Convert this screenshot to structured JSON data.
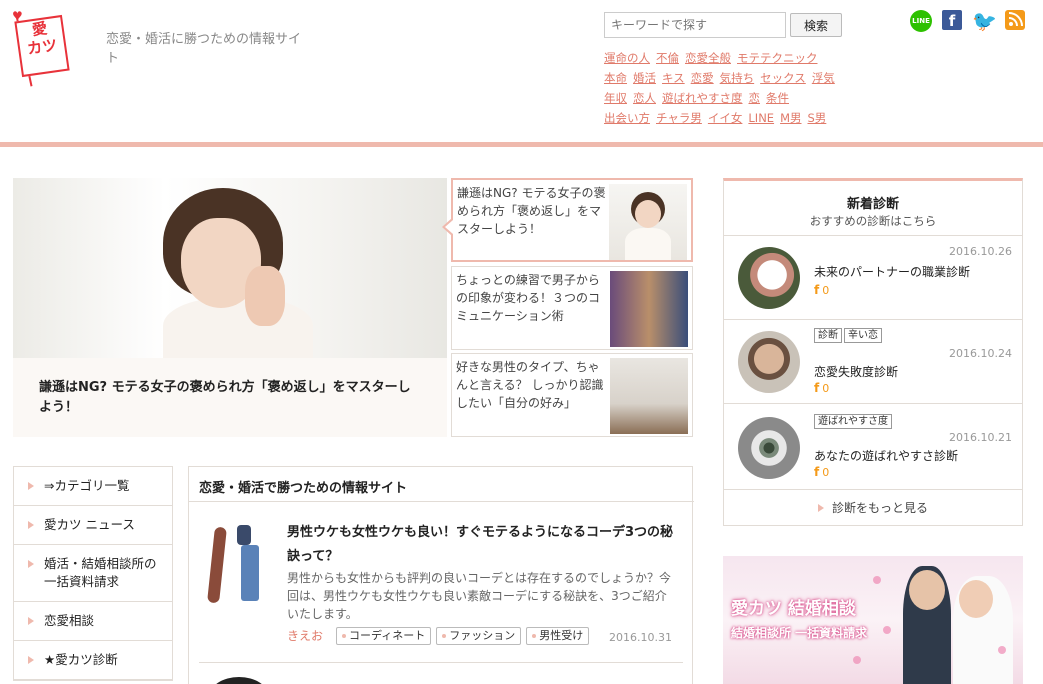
{
  "header": {
    "logo_text_top": "愛",
    "logo_text_bottom": "カツ",
    "tagline": "恋愛・婚活に勝つための情報サイト",
    "search": {
      "placeholder": "キーワードで探す",
      "button_label": "検索"
    },
    "social": [
      "line-icon",
      "facebook-icon",
      "twitter-icon",
      "rss-icon"
    ],
    "social_line_label": "LINE",
    "social_fb_label": "f",
    "social_tw_label": "🐦",
    "tag_rows": [
      [
        "運命の人",
        "不倫",
        "恋愛全般",
        "モテテクニック"
      ],
      [
        "本命",
        "婚活",
        "キス",
        "恋愛",
        "気持ち",
        "セックス",
        "浮気"
      ],
      [
        "年収",
        "恋人",
        "遊ばれやすさ度",
        "恋",
        "条件"
      ],
      [
        "出会い方",
        "チャラ男",
        "イイ女",
        "LINE",
        "M男",
        "S男"
      ]
    ]
  },
  "hero": {
    "caption": "謙遜はNG? モテる女子の褒められ方「褒め返し」をマスターしよう！"
  },
  "side_articles": [
    {
      "text": "謙遜はNG? モテる女子の褒められ方「褒め返し」をマスターしよう！"
    },
    {
      "text": "ちょっとの練習で男子からの印象が変わる！３つのコミュニケーション術"
    },
    {
      "text": "好きな男性のタイプ、ちゃんと言える？ しっかり認識したい「自分の好み」"
    }
  ],
  "left_nav": [
    "⇒カテゴリ一覧",
    "愛カツ ニュース",
    "婚活・結婚相談所の一括資料請求",
    "恋愛相談",
    "★愛カツ診断"
  ],
  "main": {
    "title": "恋愛・婚活で勝つための情報サイト",
    "article": {
      "title": "男性ウケも女性ウケも良い！すぐモテるようになるコーデ3つの秘訣って？",
      "excerpt": "男性からも女性からも評判の良いコーデとは存在するのでしょうか？今回は、男性ウケも女性ウケも良い素敵コーデにする秘訣を、3つご紹介いたします。",
      "author": "きえお",
      "tags": [
        "コーディネート",
        "ファッション",
        "男性受け"
      ],
      "date": "2016.10.31"
    }
  },
  "diagnostics": {
    "title": "新着診断",
    "subtitle": "おすすめの診断はこちら",
    "items": [
      {
        "name": "未来のパートナーの職業診断",
        "date": "2016.10.26",
        "fb_count": "0",
        "badges": []
      },
      {
        "name": "恋愛失敗度診断",
        "date": "2016.10.24",
        "fb_count": "0",
        "badges": [
          "診断",
          "辛い恋"
        ]
      },
      {
        "name": "あなたの遊ばれやすさ診断",
        "date": "2016.10.21",
        "fb_count": "0",
        "badges": [
          "遊ばれやすさ度"
        ]
      }
    ],
    "fb_icon": "f",
    "more_label": "診断をもっと見る"
  },
  "banner": {
    "title": "愛カツ 結婚相談",
    "subtitle": "結婚相談所 一括資料請求"
  },
  "colors": {
    "accent": "#efb9ad",
    "link": "#e07a6a",
    "logo_red": "#e8323a"
  }
}
